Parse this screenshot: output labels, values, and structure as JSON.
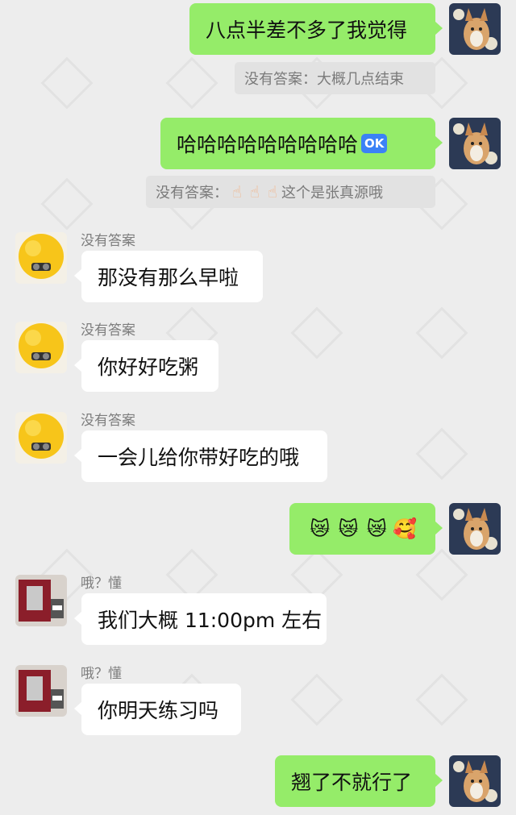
{
  "messages": [
    {
      "side": "me",
      "text": "八点半差不多了我觉得"
    },
    {
      "quote": "没有答案：大概几点结束"
    },
    {
      "side": "me",
      "text": "哈哈哈哈哈哈哈哈哈",
      "badge": "OK"
    },
    {
      "quote_prefix": "没有答案：",
      "quote_suffix": "这个是张真源哦",
      "quote_icon": "pointing-up-hand-icon"
    },
    {
      "side": "them",
      "sender": "没有答案",
      "text": "那没有那么早啦"
    },
    {
      "side": "them",
      "sender": "没有答案",
      "text": "你好好吃粥"
    },
    {
      "side": "them",
      "sender": "没有答案",
      "text": "一会儿给你带好吃的哦"
    },
    {
      "side": "me",
      "emojis": [
        "crying-cat-icon",
        "crying-cat-icon",
        "crying-cat-icon",
        "smiling-face-with-hearts-icon"
      ]
    },
    {
      "side": "them",
      "sender": "哦？懂",
      "text": "我们大概 11:00pm 左右"
    },
    {
      "side": "them",
      "sender": "哦？懂",
      "text": "你明天练习吗"
    },
    {
      "side": "me",
      "text": "翘了不就行了"
    }
  ],
  "colors": {
    "background": "#ededed",
    "my_bubble": "#95ec69",
    "their_bubble": "#ffffff",
    "quote_bg": "#e2e2e2"
  }
}
